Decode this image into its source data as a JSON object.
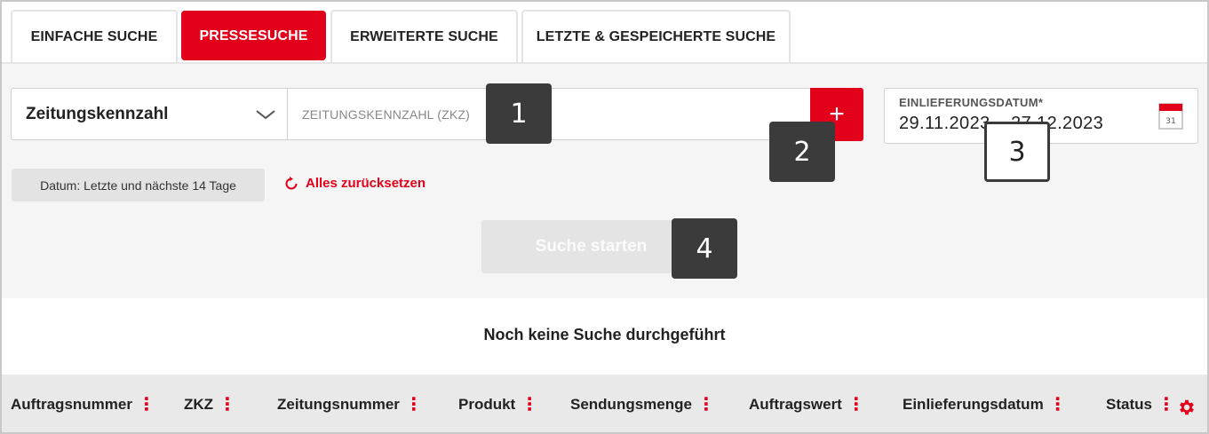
{
  "tabs": [
    {
      "label": "EINFACHE SUCHE",
      "active": false
    },
    {
      "label": "PRESSESUCHE",
      "active": true
    },
    {
      "label": "ERWEITERTE SUCHE",
      "active": false
    },
    {
      "label": "LETZTE & GESPEICHERTE SUCHE",
      "active": false
    }
  ],
  "search": {
    "field_type": "Zeitungskennzahl",
    "input_placeholder": "ZEITUNGSKENNZAHL (ZKZ)",
    "add_label": "+",
    "date_label": "EINLIEFERUNGSDATUM*",
    "date_value": "29.11.2023 – 27.12.2023",
    "calendar_day": "31",
    "filter_chip": "Datum: Letzte und nächste 14 Tage",
    "reset_label": "Alles zurücksetzen",
    "start_label": "Suche starten"
  },
  "badges": [
    "1",
    "2",
    "3",
    "4"
  ],
  "results": {
    "empty_message": "Noch keine Suche durchgeführt",
    "columns": [
      "Auftragsnummer",
      "ZKZ",
      "Zeitungsnummer",
      "Produkt",
      "Sendungsmenge",
      "Auftragswert",
      "Einlieferungsdatum",
      "Status"
    ]
  },
  "colors": {
    "accent": "#e2001a",
    "badge": "#3b3b3b",
    "panel": "#f5f5f5",
    "header": "#e9e9e9"
  },
  "icons": {
    "dropdown": "chevron-down-icon",
    "calendar": "calendar-icon",
    "reset": "refresh-icon",
    "settings": "gear-icon"
  }
}
